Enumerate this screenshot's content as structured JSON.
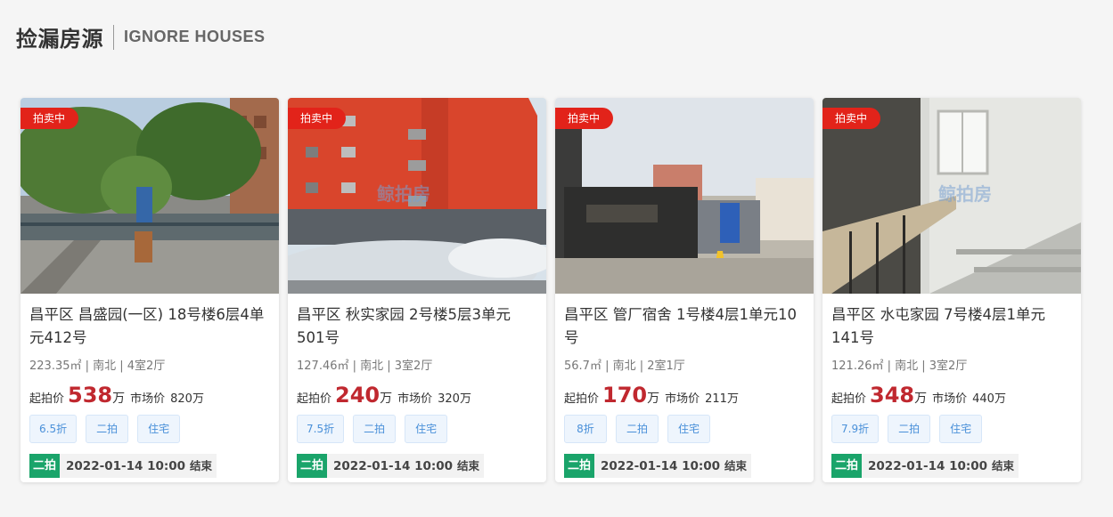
{
  "header": {
    "title_cn": "捡漏房源",
    "title_en": "IGNORE HOUSES"
  },
  "labels": {
    "start_price": "起拍价",
    "market_price": "市场价",
    "unit": "万",
    "end": "结束"
  },
  "watermark": "鲸拍房",
  "cards": [
    {
      "badge": "拍卖中",
      "name": "昌平区 昌盛园(一区) 18号楼6层4单元412号",
      "meta": "223.35㎡ | 南北 | 4室2厅",
      "start_price": "538",
      "market_price": "820万",
      "tags": [
        "6.5折",
        "二拍",
        "住宅"
      ],
      "round": "二拍",
      "time": "2022-01-14 10:00"
    },
    {
      "badge": "拍卖中",
      "name": "昌平区 秋实家园 2号楼5层3单元501号",
      "meta": "127.46㎡ | 南北 | 3室2厅",
      "start_price": "240",
      "market_price": "320万",
      "tags": [
        "7.5折",
        "二拍",
        "住宅"
      ],
      "round": "二拍",
      "time": "2022-01-14 10:00"
    },
    {
      "badge": "拍卖中",
      "name": "昌平区 管厂宿舍 1号楼4层1单元10号",
      "meta": "56.7㎡ | 南北 | 2室1厅",
      "start_price": "170",
      "market_price": "211万",
      "tags": [
        "8折",
        "二拍",
        "住宅"
      ],
      "round": "二拍",
      "time": "2022-01-14 10:00"
    },
    {
      "badge": "拍卖中",
      "name": "昌平区 水屯家园 7号楼4层1单元141号",
      "meta": "121.26㎡ | 南北 | 3室2厅",
      "start_price": "348",
      "market_price": "440万",
      "tags": [
        "7.9折",
        "二拍",
        "住宅"
      ],
      "round": "二拍",
      "time": "2022-01-14 10:00"
    }
  ]
}
